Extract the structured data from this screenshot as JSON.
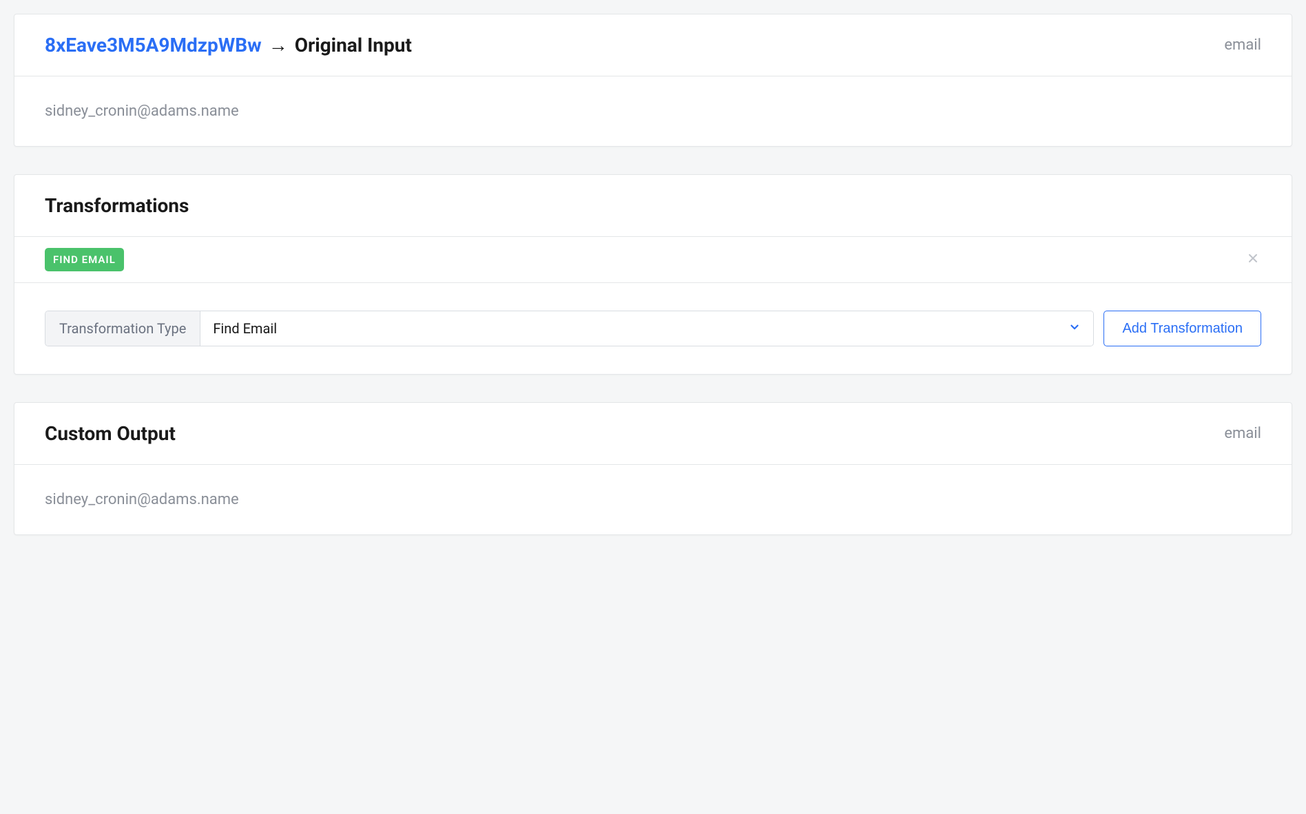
{
  "input_card": {
    "id": "8xEave3M5A9MdzpWBw",
    "arrow": "→",
    "title": "Original Input",
    "type_label": "email",
    "value": "sidney_cronin@adams.name"
  },
  "transformations": {
    "title": "Transformations",
    "badge": "FIND EMAIL",
    "form": {
      "label": "Transformation Type",
      "selected": "Find Email",
      "add_button": "Add Transformation"
    }
  },
  "output_card": {
    "title": "Custom Output",
    "type_label": "email",
    "value": "sidney_cronin@adams.name"
  }
}
